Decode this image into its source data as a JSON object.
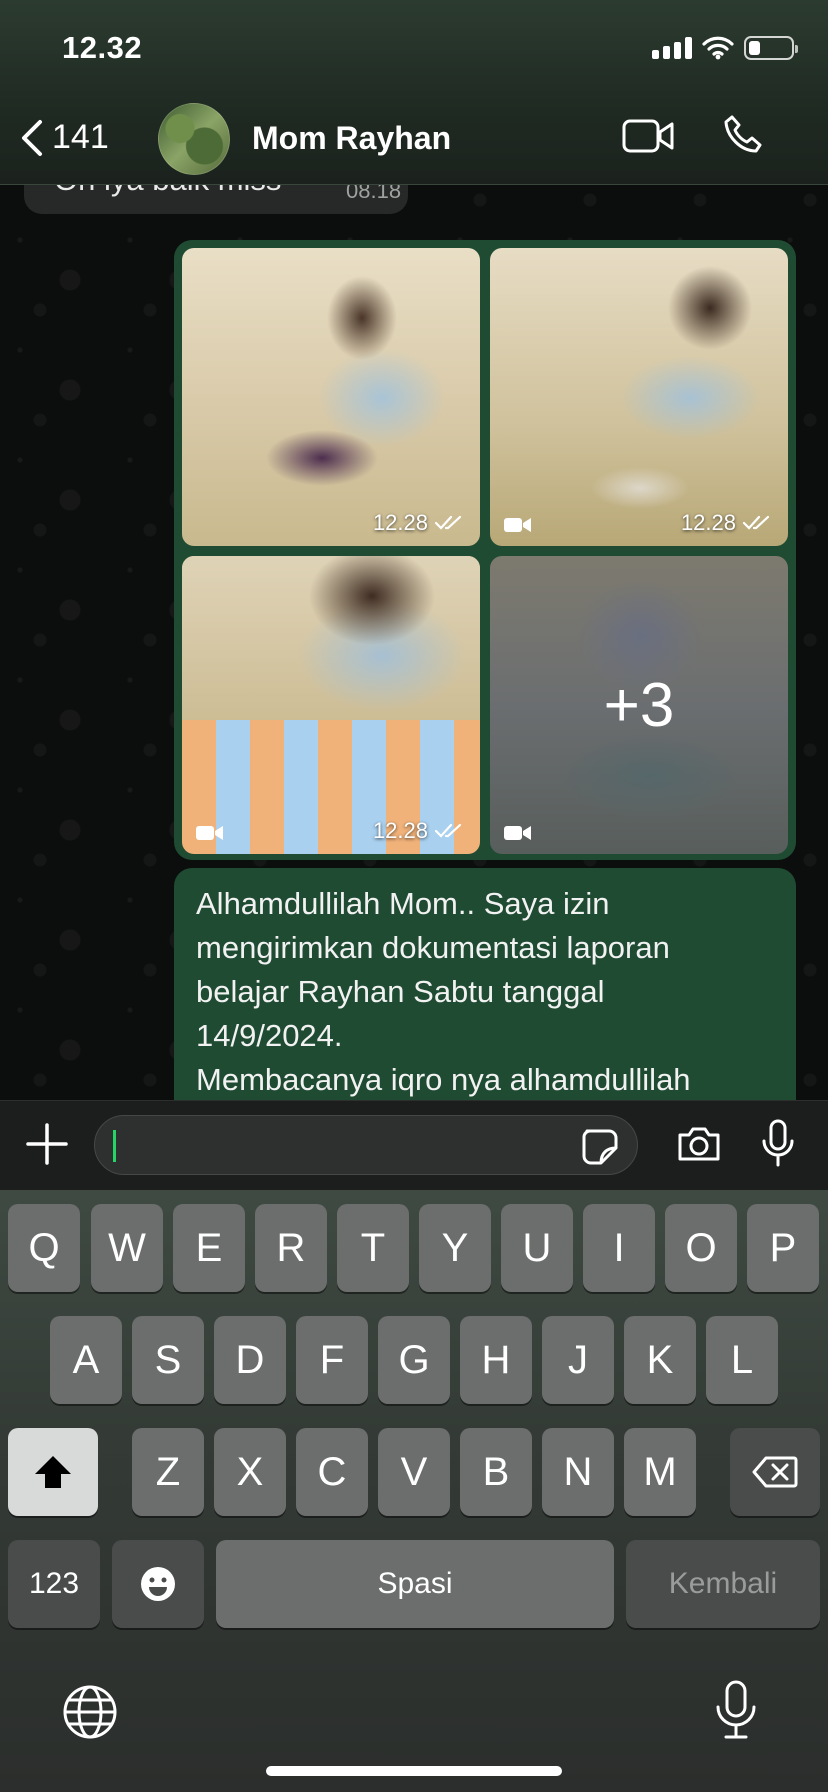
{
  "status_bar": {
    "time": "12.32"
  },
  "header": {
    "back_count": "141",
    "contact_name": "Mom Rayhan"
  },
  "messages": {
    "previous": {
      "text": "Oh iya baik miss",
      "time": "08.18"
    },
    "media": {
      "tiles": [
        {
          "time": "12.28",
          "type": "photo"
        },
        {
          "time": "12.28",
          "type": "video"
        },
        {
          "time": "12.28",
          "type": "video"
        },
        {
          "overlay": "+3",
          "type": "video"
        }
      ]
    },
    "text_lines": [
      "Alhamdullilah Mom.. Saya izin",
      "mengirimkan dokumentasi laporan",
      "belajar Rayhan Sabtu tanggal",
      "14/9/2024.",
      "Membacanya iqro nya alhamdullilah"
    ]
  },
  "keyboard": {
    "row1": [
      "Q",
      "W",
      "E",
      "R",
      "T",
      "Y",
      "U",
      "I",
      "O",
      "P"
    ],
    "row2": [
      "A",
      "S",
      "D",
      "F",
      "G",
      "H",
      "J",
      "K",
      "L"
    ],
    "row3": [
      "Z",
      "X",
      "C",
      "V",
      "B",
      "N",
      "M"
    ],
    "numbers_key": "123",
    "space_key": "Spasi",
    "return_key": "Kembali"
  },
  "colors": {
    "bubble_outgoing": "#1f4b33",
    "bubble_incoming": "#262928",
    "accent": "#25d366"
  }
}
